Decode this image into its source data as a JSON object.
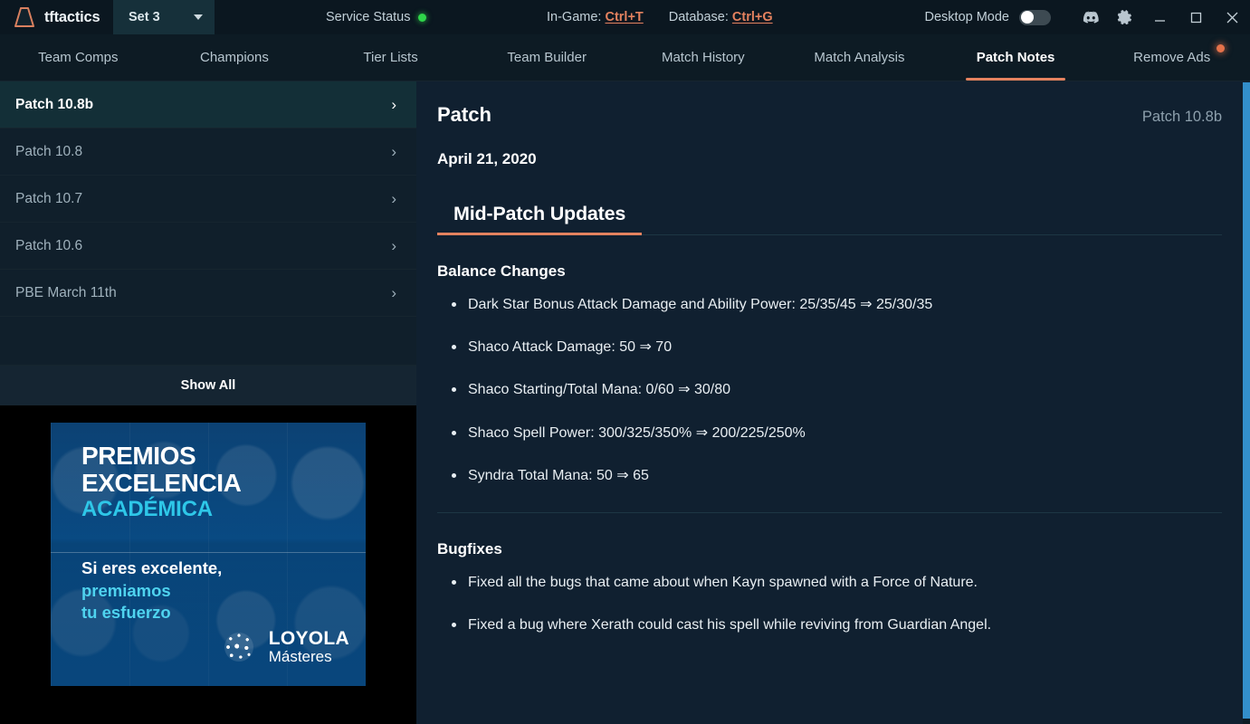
{
  "titlebar": {
    "brand_name": "tftactics",
    "brand_icon": "tftactics-logo-icon",
    "set_select": {
      "value": "Set 3",
      "caret_icon": "chevron-down-icon"
    },
    "service_status": {
      "label": "Service Status",
      "state_color": "#2fd64a",
      "icon": "status-dot-icon"
    },
    "hotkeys": [
      {
        "label": "In-Game:",
        "key": "Ctrl+T"
      },
      {
        "label": "Database:",
        "key": "Ctrl+G"
      }
    ],
    "desktop_mode": {
      "label": "Desktop Mode",
      "enabled": false
    },
    "icons": [
      {
        "name": "discord-icon"
      },
      {
        "name": "gear-icon"
      }
    ],
    "window_controls": [
      {
        "name": "minimize-icon"
      },
      {
        "name": "maximize-icon"
      },
      {
        "name": "close-icon"
      }
    ]
  },
  "nav": {
    "active": "Patch Notes",
    "accent_color": "#e4825f",
    "tabs": [
      {
        "label": "Team Comps",
        "active": false,
        "badge": false
      },
      {
        "label": "Champions",
        "active": false,
        "badge": false
      },
      {
        "label": "Tier Lists",
        "active": false,
        "badge": false
      },
      {
        "label": "Team Builder",
        "active": false,
        "badge": false
      },
      {
        "label": "Match History",
        "active": false,
        "badge": false
      },
      {
        "label": "Match Analysis",
        "active": false,
        "badge": false
      },
      {
        "label": "Patch Notes",
        "active": true,
        "badge": false
      },
      {
        "label": "Remove Ads",
        "active": false,
        "badge": true
      }
    ]
  },
  "sidebar": {
    "items": [
      {
        "label": "Patch 10.8b",
        "active": true,
        "chevron": "chevron-right-icon"
      },
      {
        "label": "Patch 10.8",
        "active": false,
        "chevron": "chevron-right-icon"
      },
      {
        "label": "Patch 10.7",
        "active": false,
        "chevron": "chevron-right-icon"
      },
      {
        "label": "Patch 10.6",
        "active": false,
        "chevron": "chevron-right-icon"
      },
      {
        "label": "PBE March 11th",
        "active": false,
        "chevron": "chevron-right-icon"
      }
    ],
    "show_all_label": "Show All"
  },
  "ad": {
    "title_line1": "PREMIOS",
    "title_line2": "EXCELENCIA",
    "subtitle": "ACADÉMICA",
    "tagline_line1": "Si eres excelente,",
    "tagline_line2": "premiamos",
    "tagline_line3": "tu esfuerzo",
    "brand_line1": "LOYOLA",
    "brand_line2": "Másteres",
    "logo_icon": "loyola-globe-icon",
    "accent_color": "#2ec7e8"
  },
  "main": {
    "title": "Patch",
    "version": "Patch 10.8b",
    "date": "April 21, 2020",
    "section_tab": "Mid-Patch Updates",
    "sections": [
      {
        "heading": "Balance Changes",
        "items": [
          "Dark Star Bonus Attack Damage and Ability Power: 25/35/45 ⇒ 25/30/35",
          "Shaco Attack Damage: 50 ⇒ 70",
          "Shaco Starting/Total Mana: 0/60 ⇒ 30/80",
          "Shaco Spell Power: 300/325/350% ⇒ 200/225/250%",
          "Syndra Total Mana: 50 ⇒ 65"
        ]
      },
      {
        "heading": "Bugfixes",
        "items": [
          "Fixed all the bugs that came about when Kayn spawned with a Force of Nature.",
          "Fixed a bug where Xerath could cast his spell while reviving from Guardian Angel."
        ]
      }
    ]
  },
  "scrollbar": {
    "color": "#338fcb"
  }
}
